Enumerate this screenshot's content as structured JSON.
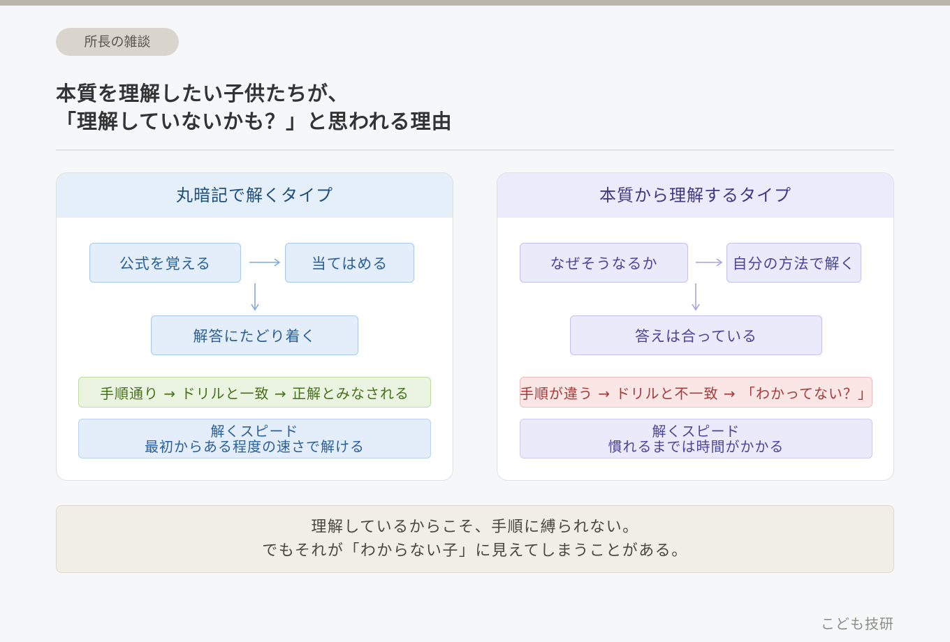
{
  "tag": "所長の雑談",
  "headline": {
    "line1": "本質を理解したい子供たちが、",
    "line2": "「理解していないかも？」と思われる理由"
  },
  "left_card": {
    "title": "丸暗記で解くタイプ",
    "step1": "公式を覚える",
    "step2": "当てはめる",
    "step3": "解答にたどり着く",
    "result": "手順通り → ドリルと一致 → 正解とみなされる",
    "speed_title": "解くスピード",
    "speed_desc": "最初からある程度の速さで解ける"
  },
  "right_card": {
    "title": "本質から理解するタイプ",
    "step1": "なぜそうなるか",
    "step2": "自分の方法で解く",
    "step3": "答えは合っている",
    "result": "手順が違う → ドリルと不一致 → 「わかってない？」",
    "speed_title": "解くスピード",
    "speed_desc": "慣れるまでは時間がかかる"
  },
  "summary": {
    "line1": "理解しているからこそ、手順に縛られない。",
    "line2": "でもそれが「わからない子」に見えてしまうことがある。"
  },
  "footer": "こども技研",
  "colors": {
    "left_accent": "#2a5f97",
    "right_accent": "#4a4697",
    "good": "#46701c",
    "bad": "#a43b3b"
  }
}
